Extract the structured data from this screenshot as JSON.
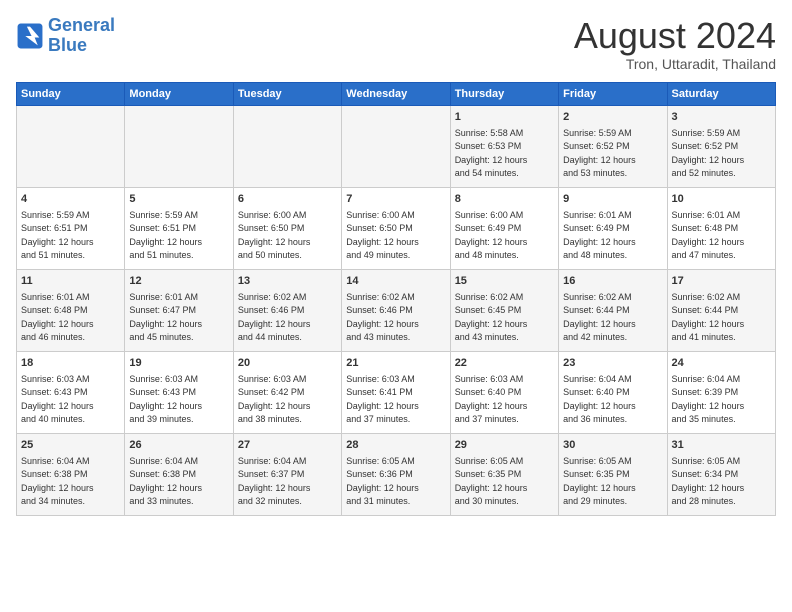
{
  "logo": {
    "line1": "General",
    "line2": "Blue"
  },
  "title": "August 2024",
  "location": "Tron, Uttaradit, Thailand",
  "days_of_week": [
    "Sunday",
    "Monday",
    "Tuesday",
    "Wednesday",
    "Thursday",
    "Friday",
    "Saturday"
  ],
  "weeks": [
    [
      {
        "day": "",
        "info": ""
      },
      {
        "day": "",
        "info": ""
      },
      {
        "day": "",
        "info": ""
      },
      {
        "day": "",
        "info": ""
      },
      {
        "day": "1",
        "info": "Sunrise: 5:58 AM\nSunset: 6:53 PM\nDaylight: 12 hours\nand 54 minutes."
      },
      {
        "day": "2",
        "info": "Sunrise: 5:59 AM\nSunset: 6:52 PM\nDaylight: 12 hours\nand 53 minutes."
      },
      {
        "day": "3",
        "info": "Sunrise: 5:59 AM\nSunset: 6:52 PM\nDaylight: 12 hours\nand 52 minutes."
      }
    ],
    [
      {
        "day": "4",
        "info": "Sunrise: 5:59 AM\nSunset: 6:51 PM\nDaylight: 12 hours\nand 51 minutes."
      },
      {
        "day": "5",
        "info": "Sunrise: 5:59 AM\nSunset: 6:51 PM\nDaylight: 12 hours\nand 51 minutes."
      },
      {
        "day": "6",
        "info": "Sunrise: 6:00 AM\nSunset: 6:50 PM\nDaylight: 12 hours\nand 50 minutes."
      },
      {
        "day": "7",
        "info": "Sunrise: 6:00 AM\nSunset: 6:50 PM\nDaylight: 12 hours\nand 49 minutes."
      },
      {
        "day": "8",
        "info": "Sunrise: 6:00 AM\nSunset: 6:49 PM\nDaylight: 12 hours\nand 48 minutes."
      },
      {
        "day": "9",
        "info": "Sunrise: 6:01 AM\nSunset: 6:49 PM\nDaylight: 12 hours\nand 48 minutes."
      },
      {
        "day": "10",
        "info": "Sunrise: 6:01 AM\nSunset: 6:48 PM\nDaylight: 12 hours\nand 47 minutes."
      }
    ],
    [
      {
        "day": "11",
        "info": "Sunrise: 6:01 AM\nSunset: 6:48 PM\nDaylight: 12 hours\nand 46 minutes."
      },
      {
        "day": "12",
        "info": "Sunrise: 6:01 AM\nSunset: 6:47 PM\nDaylight: 12 hours\nand 45 minutes."
      },
      {
        "day": "13",
        "info": "Sunrise: 6:02 AM\nSunset: 6:46 PM\nDaylight: 12 hours\nand 44 minutes."
      },
      {
        "day": "14",
        "info": "Sunrise: 6:02 AM\nSunset: 6:46 PM\nDaylight: 12 hours\nand 43 minutes."
      },
      {
        "day": "15",
        "info": "Sunrise: 6:02 AM\nSunset: 6:45 PM\nDaylight: 12 hours\nand 43 minutes."
      },
      {
        "day": "16",
        "info": "Sunrise: 6:02 AM\nSunset: 6:44 PM\nDaylight: 12 hours\nand 42 minutes."
      },
      {
        "day": "17",
        "info": "Sunrise: 6:02 AM\nSunset: 6:44 PM\nDaylight: 12 hours\nand 41 minutes."
      }
    ],
    [
      {
        "day": "18",
        "info": "Sunrise: 6:03 AM\nSunset: 6:43 PM\nDaylight: 12 hours\nand 40 minutes."
      },
      {
        "day": "19",
        "info": "Sunrise: 6:03 AM\nSunset: 6:43 PM\nDaylight: 12 hours\nand 39 minutes."
      },
      {
        "day": "20",
        "info": "Sunrise: 6:03 AM\nSunset: 6:42 PM\nDaylight: 12 hours\nand 38 minutes."
      },
      {
        "day": "21",
        "info": "Sunrise: 6:03 AM\nSunset: 6:41 PM\nDaylight: 12 hours\nand 37 minutes."
      },
      {
        "day": "22",
        "info": "Sunrise: 6:03 AM\nSunset: 6:40 PM\nDaylight: 12 hours\nand 37 minutes."
      },
      {
        "day": "23",
        "info": "Sunrise: 6:04 AM\nSunset: 6:40 PM\nDaylight: 12 hours\nand 36 minutes."
      },
      {
        "day": "24",
        "info": "Sunrise: 6:04 AM\nSunset: 6:39 PM\nDaylight: 12 hours\nand 35 minutes."
      }
    ],
    [
      {
        "day": "25",
        "info": "Sunrise: 6:04 AM\nSunset: 6:38 PM\nDaylight: 12 hours\nand 34 minutes."
      },
      {
        "day": "26",
        "info": "Sunrise: 6:04 AM\nSunset: 6:38 PM\nDaylight: 12 hours\nand 33 minutes."
      },
      {
        "day": "27",
        "info": "Sunrise: 6:04 AM\nSunset: 6:37 PM\nDaylight: 12 hours\nand 32 minutes."
      },
      {
        "day": "28",
        "info": "Sunrise: 6:05 AM\nSunset: 6:36 PM\nDaylight: 12 hours\nand 31 minutes."
      },
      {
        "day": "29",
        "info": "Sunrise: 6:05 AM\nSunset: 6:35 PM\nDaylight: 12 hours\nand 30 minutes."
      },
      {
        "day": "30",
        "info": "Sunrise: 6:05 AM\nSunset: 6:35 PM\nDaylight: 12 hours\nand 29 minutes."
      },
      {
        "day": "31",
        "info": "Sunrise: 6:05 AM\nSunset: 6:34 PM\nDaylight: 12 hours\nand 28 minutes."
      }
    ]
  ]
}
